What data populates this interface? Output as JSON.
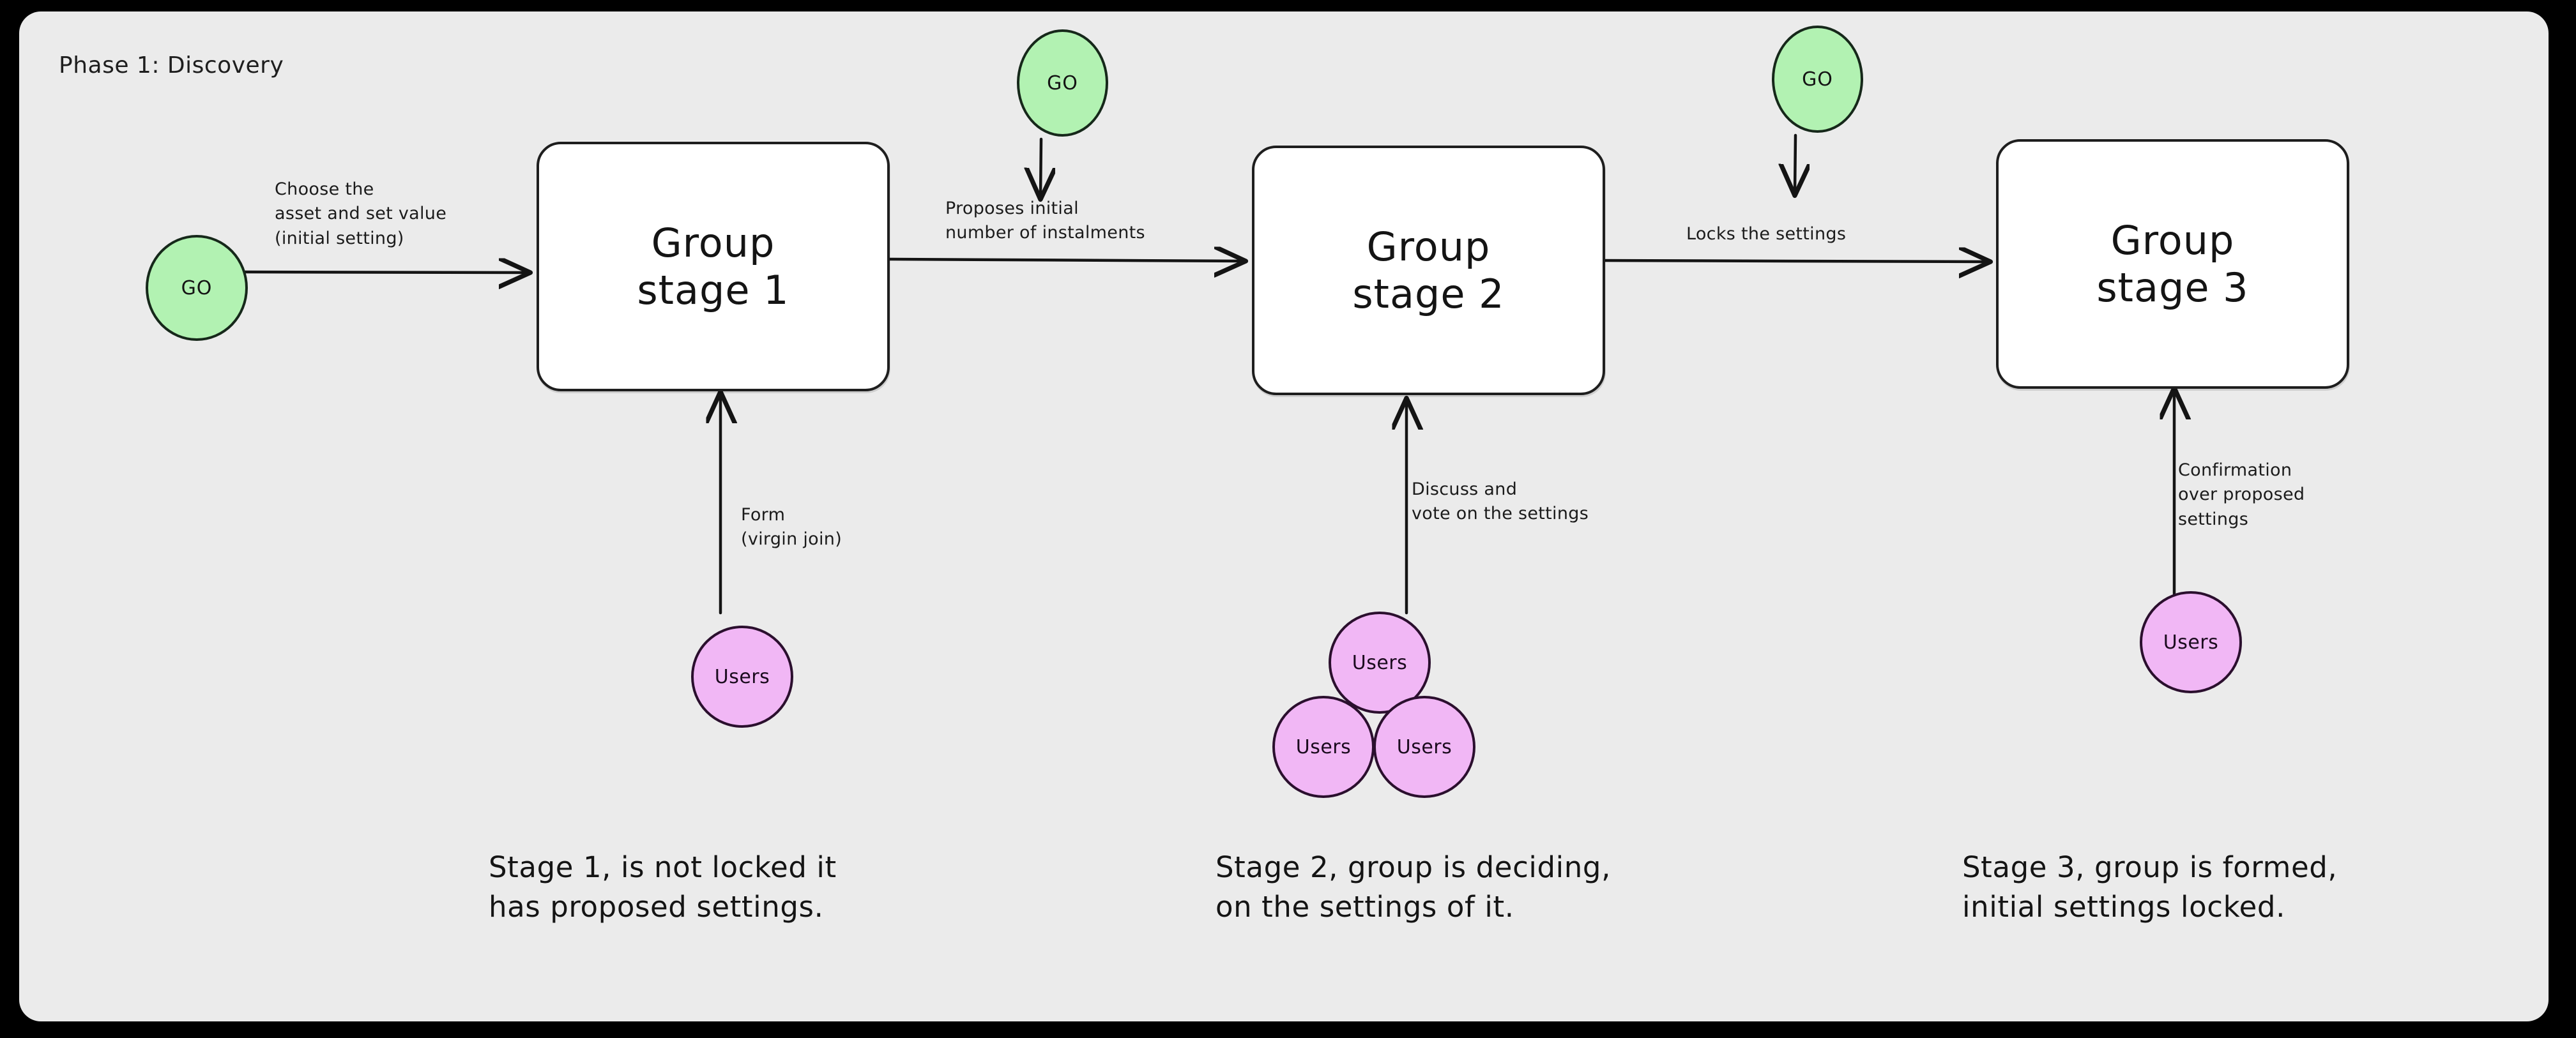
{
  "canvas": {
    "title": "Phase 1: Discovery",
    "bg_color": "#ebebeb",
    "frame_color": "#000000"
  },
  "palette": {
    "go_fill": "#b2f2b2",
    "go_stroke": "#16281a",
    "users_fill": "#f1b7f5",
    "users_stroke": "#2b0f2e",
    "box_fill": "#ffffff",
    "box_stroke": "#1e1e1e",
    "ink": "#141414"
  },
  "nodes": {
    "go_left": {
      "label": "GO"
    },
    "go_mid": {
      "label": "GO"
    },
    "go_right": {
      "label": "GO"
    },
    "box1": {
      "line1": "Group",
      "line2": "stage 1"
    },
    "box2": {
      "line1": "Group",
      "line2": "stage 2"
    },
    "box3": {
      "line1": "Group",
      "line2": "stage 3"
    },
    "users_b1": {
      "label": "Users"
    },
    "users_b2_top": {
      "label": "Users"
    },
    "users_b2_left": {
      "label": "Users"
    },
    "users_b2_right": {
      "label": "Users"
    },
    "users_b3": {
      "label": "Users"
    }
  },
  "edge_labels": {
    "go_to_box1": "Choose the\nasset and set value\n(initial setting)",
    "box1_to_box2": "Proposes initial\nnumber of instalments",
    "box2_to_box3": "Locks the settings",
    "users_to_box1": "Form\n(virgin join)",
    "users_to_box2": "Discuss and\nvote on the settings",
    "users_to_box3": "Confirmation\nover proposed\nsettings"
  },
  "captions": {
    "stage1": "Stage 1, is not locked it\nhas proposed settings.",
    "stage2": "Stage 2, group is deciding,\non the settings of it.",
    "stage3": "Stage 3, group is formed,\ninitial settings locked."
  }
}
